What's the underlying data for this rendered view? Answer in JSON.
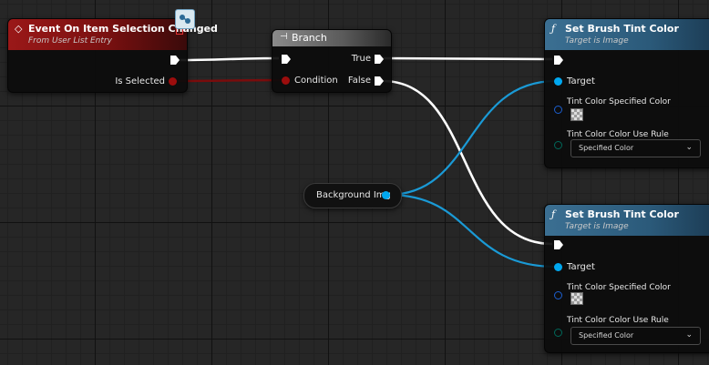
{
  "event_node": {
    "title": "Event On Item Selection Changed",
    "subtitle": "From User List Entry",
    "pins": {
      "is_selected": "Is Selected"
    }
  },
  "branch_node": {
    "title": "Branch",
    "pins": {
      "condition": "Condition",
      "true": "True",
      "false": "False"
    }
  },
  "variable_node": {
    "label": "Background Img"
  },
  "set_tint_nodes": [
    {
      "title": "Set Brush Tint Color",
      "subtitle": "Target is Image",
      "pins": {
        "target": "Target",
        "specified_color": "Tint Color Specified Color",
        "color_use_rule": "Tint Color Color Use Rule"
      },
      "color_use_rule_value": "Specified Color"
    },
    {
      "title": "Set Brush Tint Color",
      "subtitle": "Target is Image",
      "pins": {
        "target": "Target",
        "specified_color": "Tint Color Specified Color",
        "color_use_rule": "Tint Color Color Use Rule"
      },
      "color_use_rule_value": "Specified Color"
    }
  ],
  "colors": {
    "event_header": "#8a1414",
    "branch_header": "#6e6e6e",
    "function_header": "#2b5a7a",
    "bool_pin": "#8c0b0b",
    "object_pin": "#00a8f0",
    "linear_color_pin": "#1c5fd0",
    "enum_pin": "#00685a",
    "exec_wire": "#ffffff"
  },
  "icons": {
    "event": "event-diamond-icon",
    "branch": "branch-icon",
    "function": "function-icon",
    "replicated": "network-replicated-icon",
    "dropdown": "chevron-down-icon"
  }
}
